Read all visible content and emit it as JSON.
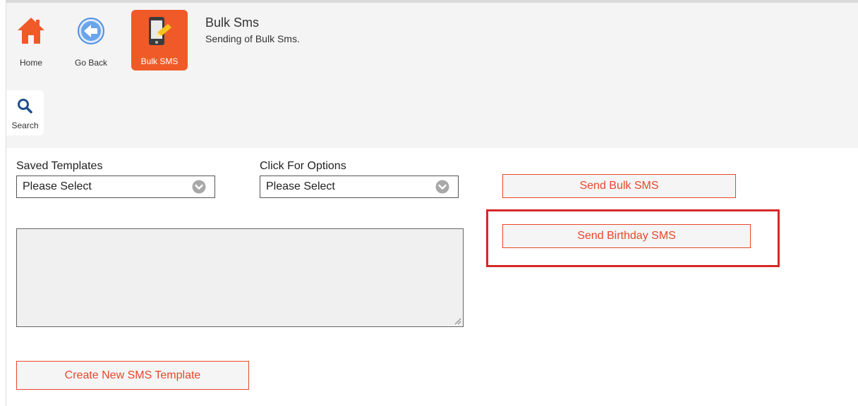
{
  "toolbar": {
    "home_label": "Home",
    "back_label": "Go Back",
    "bulk_label": "Bulk SMS",
    "search_label": "Search"
  },
  "page": {
    "title": "Bulk Sms",
    "subtitle": "Sending of Bulk Sms."
  },
  "form": {
    "saved_templates_label": "Saved Templates",
    "saved_templates_value": "Please Select",
    "options_label": "Click For Options",
    "options_value": "Please Select",
    "message_value": ""
  },
  "actions": {
    "send_bulk": "Send Bulk SMS",
    "send_birthday": "Send Birthday SMS",
    "create_template": "Create New SMS Template"
  },
  "colors": {
    "accent": "#f05a28",
    "button_text": "#e8472a",
    "highlight": "#d62828",
    "header_bg": "#f4f4f4",
    "back_icon": "#4f8fe0"
  },
  "icons": {
    "home": "home-icon",
    "back": "arrow-left-circle-icon",
    "bulk": "phone-sms-icon",
    "search": "search-icon",
    "dropdown": "chevron-down-circle-icon"
  }
}
